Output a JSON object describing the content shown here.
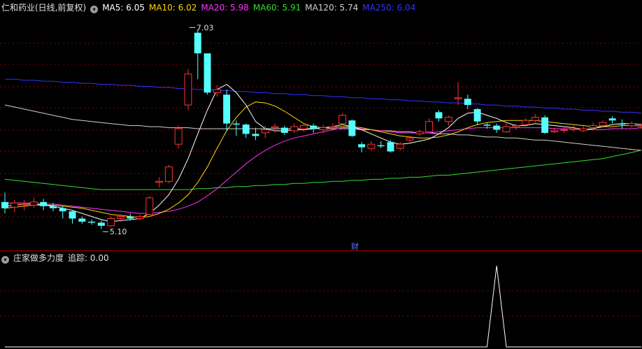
{
  "main_legend": {
    "title": "仁和药业(日线,前复权)",
    "items": [
      {
        "label": "MA5: 6.05",
        "color": "#ffffff"
      },
      {
        "label": "MA10: 6.02",
        "color": "#ffd700"
      },
      {
        "label": "MA20: 5.98",
        "color": "#ff33ff"
      },
      {
        "label": "MA60: 5.91",
        "color": "#33dd33"
      },
      {
        "label": "MA120: 5.74",
        "color": "#d0d0d0"
      },
      {
        "label": "MA250: 6.04",
        "color": "#3333ff"
      }
    ]
  },
  "indicator_legend": {
    "name": "庄家做多力度",
    "value_label": "追踪: 0.00"
  },
  "marker_label": "财",
  "chart_data": [
    {
      "type": "candlestick",
      "price_range": [
        5.0,
        7.1
      ],
      "max_annotation": {
        "label": "7.03",
        "value": 7.03,
        "index": 19
      },
      "min_annotation": {
        "label": "5.10",
        "value": 5.1,
        "index": 10
      },
      "colors": {
        "up": "#ff3232",
        "down": "#54ffff",
        "ma5": "#ffffff",
        "ma10": "#ffd700",
        "ma20": "#ff33ff",
        "ma60": "#33dd33",
        "ma120": "#d0d0d0",
        "ma250": "#3333ff"
      },
      "candles": [
        [
          5.36,
          5.3,
          5.45,
          5.25
        ],
        [
          5.31,
          5.35,
          5.38,
          5.26
        ],
        [
          5.34,
          5.34,
          5.38,
          5.28
        ],
        [
          5.33,
          5.36,
          5.4,
          5.3
        ],
        [
          5.36,
          5.32,
          5.39,
          5.28
        ],
        [
          5.32,
          5.3,
          5.35,
          5.27
        ],
        [
          5.3,
          5.27,
          5.32,
          5.2
        ],
        [
          5.27,
          5.2,
          5.28,
          5.15
        ],
        [
          5.2,
          5.17,
          5.22,
          5.15
        ],
        [
          5.17,
          5.16,
          5.19,
          5.14
        ],
        [
          5.16,
          5.13,
          5.18,
          5.1
        ],
        [
          5.13,
          5.2,
          5.22,
          5.12
        ],
        [
          5.2,
          5.22,
          5.24,
          5.17
        ],
        [
          5.22,
          5.2,
          5.25,
          5.18
        ],
        [
          5.2,
          5.22,
          5.24,
          5.18
        ],
        [
          5.24,
          5.4,
          5.42,
          5.23
        ],
        [
          5.55,
          5.56,
          5.6,
          5.5
        ],
        [
          5.56,
          5.7,
          5.72,
          5.54
        ],
        [
          5.92,
          6.07,
          6.1,
          5.88
        ],
        [
          6.3,
          6.6,
          6.65,
          6.25
        ],
        [
          7.0,
          6.8,
          7.03,
          6.55
        ],
        [
          6.8,
          6.42,
          6.78,
          6.4
        ],
        [
          6.42,
          6.45,
          6.49,
          6.38
        ],
        [
          6.4,
          6.12,
          6.45,
          6.05
        ],
        [
          6.12,
          6.11,
          6.15,
          6.0
        ],
        [
          6.11,
          6.02,
          6.12,
          5.98
        ],
        [
          6.02,
          6.0,
          6.08,
          5.96
        ],
        [
          6.03,
          6.06,
          6.1,
          5.98
        ],
        [
          6.08,
          6.09,
          6.12,
          6.03
        ],
        [
          6.08,
          6.03,
          6.1,
          6.01
        ],
        [
          6.05,
          6.09,
          6.12,
          6.03
        ],
        [
          6.07,
          6.1,
          6.12,
          6.04
        ],
        [
          6.1,
          6.07,
          6.12,
          6.03
        ],
        [
          6.06,
          6.08,
          6.11,
          6.03
        ],
        [
          6.08,
          6.09,
          6.12,
          6.05
        ],
        [
          6.12,
          6.2,
          6.22,
          6.11
        ],
        [
          6.15,
          6.0,
          6.16,
          5.99
        ],
        [
          5.92,
          5.89,
          5.94,
          5.84
        ],
        [
          5.88,
          5.92,
          5.95,
          5.86
        ],
        [
          5.91,
          5.9,
          5.95,
          5.88
        ],
        [
          5.94,
          5.85,
          5.96,
          5.84
        ],
        [
          5.88,
          5.92,
          5.94,
          5.86
        ],
        [
          5.96,
          5.98,
          6.0,
          5.94
        ],
        [
          6.02,
          6.04,
          6.06,
          6.0
        ],
        [
          6.04,
          6.14,
          6.17,
          6.03
        ],
        [
          6.23,
          6.17,
          6.25,
          6.14
        ],
        [
          6.14,
          6.18,
          6.2,
          6.1
        ],
        [
          6.36,
          6.37,
          6.52,
          6.3
        ],
        [
          6.36,
          6.3,
          6.4,
          6.26
        ],
        [
          6.26,
          6.14,
          6.27,
          6.11
        ],
        [
          6.11,
          6.1,
          6.13,
          6.07
        ],
        [
          6.1,
          6.06,
          6.12,
          6.03
        ],
        [
          6.04,
          6.09,
          6.12,
          6.03
        ],
        [
          6.09,
          6.1,
          6.12,
          6.06
        ],
        [
          6.11,
          6.15,
          6.17,
          6.09
        ],
        [
          6.15,
          6.18,
          6.21,
          6.13
        ],
        [
          6.18,
          6.03,
          6.2,
          6.02
        ],
        [
          6.04,
          6.05,
          6.08,
          6.03
        ],
        [
          6.06,
          6.06,
          6.09,
          6.03
        ],
        [
          6.06,
          6.07,
          6.1,
          6.04
        ],
        [
          6.05,
          6.07,
          6.11,
          6.04
        ],
        [
          6.08,
          6.1,
          6.13,
          6.06
        ],
        [
          6.1,
          6.13,
          6.15,
          6.09
        ],
        [
          6.17,
          6.15,
          6.19,
          6.12
        ],
        [
          6.12,
          6.11,
          6.16,
          6.07
        ],
        [
          6.1,
          6.12,
          6.14,
          6.08
        ],
        [
          6.09,
          6.1,
          6.12,
          6.07
        ]
      ],
      "ma5": [
        5.32,
        5.33,
        5.34,
        5.34,
        5.33,
        5.32,
        5.3,
        5.28,
        5.25,
        5.22,
        5.19,
        5.17,
        5.18,
        5.19,
        5.2,
        5.25,
        5.33,
        5.43,
        5.58,
        5.78,
        6.02,
        6.25,
        6.45,
        6.5,
        6.42,
        6.3,
        6.14,
        6.07,
        6.05,
        6.05,
        6.06,
        6.06,
        6.07,
        6.08,
        6.09,
        6.11,
        6.09,
        6.06,
        6.02,
        5.98,
        5.94,
        5.92,
        5.93,
        5.95,
        5.97,
        6.02,
        6.08,
        6.17,
        6.22,
        6.23,
        6.2,
        6.17,
        6.13,
        6.1,
        6.1,
        6.12,
        6.11,
        6.1,
        6.09,
        6.08,
        6.06,
        6.07,
        6.09,
        6.11,
        6.12,
        6.12,
        6.11
      ],
      "ma10": [
        5.3,
        5.31,
        5.32,
        5.33,
        5.33,
        5.33,
        5.32,
        5.31,
        5.3,
        5.28,
        5.26,
        5.24,
        5.23,
        5.22,
        5.21,
        5.22,
        5.25,
        5.29,
        5.35,
        5.43,
        5.55,
        5.7,
        5.88,
        6.05,
        6.18,
        6.28,
        6.33,
        6.32,
        6.29,
        6.24,
        6.18,
        6.12,
        6.09,
        6.08,
        6.08,
        6.09,
        6.09,
        6.08,
        6.06,
        6.04,
        6.02,
        6.0,
        5.99,
        5.98,
        5.98,
        5.99,
        6.01,
        6.04,
        6.08,
        6.11,
        6.13,
        6.14,
        6.15,
        6.15,
        6.15,
        6.15,
        6.14,
        6.13,
        6.12,
        6.11,
        6.1,
        6.09,
        6.09,
        6.09,
        6.1,
        6.1,
        6.1
      ],
      "ma20": [
        5.35,
        5.35,
        5.35,
        5.35,
        5.34,
        5.34,
        5.33,
        5.32,
        5.31,
        5.3,
        5.29,
        5.28,
        5.27,
        5.26,
        5.25,
        5.25,
        5.26,
        5.27,
        5.29,
        5.32,
        5.36,
        5.42,
        5.49,
        5.57,
        5.65,
        5.73,
        5.8,
        5.86,
        5.91,
        5.95,
        5.98,
        6.0,
        6.02,
        6.04,
        6.06,
        6.08,
        6.08,
        6.07,
        6.06,
        6.05,
        6.04,
        6.03,
        6.03,
        6.03,
        6.03,
        6.04,
        6.05,
        6.06,
        6.07,
        6.08,
        6.08,
        6.08,
        6.08,
        6.08,
        6.08,
        6.08,
        6.08,
        6.07,
        6.07,
        6.07,
        6.06,
        6.06,
        6.06,
        6.07,
        6.07,
        6.07,
        6.08
      ],
      "ma60": [
        5.58,
        5.57,
        5.56,
        5.55,
        5.54,
        5.53,
        5.52,
        5.51,
        5.5,
        5.49,
        5.48,
        5.48,
        5.48,
        5.48,
        5.48,
        5.48,
        5.48,
        5.48,
        5.48,
        5.48,
        5.49,
        5.49,
        5.5,
        5.5,
        5.51,
        5.51,
        5.52,
        5.52,
        5.53,
        5.53,
        5.54,
        5.54,
        5.55,
        5.55,
        5.56,
        5.56,
        5.57,
        5.57,
        5.58,
        5.58,
        5.59,
        5.59,
        5.6,
        5.6,
        5.61,
        5.62,
        5.62,
        5.63,
        5.64,
        5.65,
        5.66,
        5.67,
        5.68,
        5.69,
        5.7,
        5.71,
        5.72,
        5.73,
        5.74,
        5.75,
        5.76,
        5.77,
        5.78,
        5.8,
        5.82,
        5.84,
        5.86
      ],
      "ma120": [
        6.3,
        6.28,
        6.26,
        6.24,
        6.22,
        6.2,
        6.18,
        6.16,
        6.15,
        6.14,
        6.13,
        6.12,
        6.11,
        6.1,
        6.1,
        6.09,
        6.09,
        6.08,
        6.08,
        6.08,
        6.07,
        6.07,
        6.07,
        6.07,
        6.07,
        6.07,
        6.07,
        6.07,
        6.07,
        6.07,
        6.07,
        6.07,
        6.07,
        6.07,
        6.07,
        6.07,
        6.07,
        6.06,
        6.06,
        6.05,
        6.05,
        6.04,
        6.04,
        6.03,
        6.03,
        6.02,
        6.02,
        6.01,
        6.01,
        6.0,
        5.99,
        5.99,
        5.98,
        5.98,
        5.97,
        5.96,
        5.96,
        5.95,
        5.94,
        5.93,
        5.92,
        5.91,
        5.9,
        5.89,
        5.88,
        5.87,
        5.86
      ],
      "ma250": [
        6.55,
        6.55,
        6.54,
        6.54,
        6.53,
        6.53,
        6.52,
        6.52,
        6.51,
        6.51,
        6.5,
        6.5,
        6.49,
        6.49,
        6.48,
        6.48,
        6.47,
        6.47,
        6.46,
        6.46,
        6.45,
        6.45,
        6.44,
        6.44,
        6.43,
        6.43,
        6.42,
        6.42,
        6.41,
        6.41,
        6.4,
        6.4,
        6.39,
        6.39,
        6.38,
        6.38,
        6.37,
        6.37,
        6.36,
        6.36,
        6.35,
        6.35,
        6.34,
        6.34,
        6.33,
        6.33,
        6.32,
        6.32,
        6.31,
        6.31,
        6.3,
        6.3,
        6.29,
        6.29,
        6.28,
        6.28,
        6.27,
        6.27,
        6.26,
        6.26,
        6.25,
        6.25,
        6.24,
        6.24,
        6.23,
        6.23,
        6.22
      ]
    },
    {
      "type": "line",
      "name": "庄家做多力度",
      "value_range": [
        0,
        1
      ],
      "values": [
        0,
        0,
        0,
        0,
        0,
        0,
        0,
        0,
        0,
        0,
        0,
        0,
        0,
        0,
        0,
        0,
        0,
        0,
        0,
        0,
        0,
        0,
        0,
        0,
        0,
        0,
        0,
        0,
        0,
        0,
        0,
        0,
        0,
        0,
        0,
        0,
        0,
        0,
        0,
        0,
        0,
        0,
        0,
        0,
        0,
        0,
        0,
        0,
        0,
        0,
        0,
        1,
        0,
        0,
        0,
        0,
        0,
        0,
        0,
        0,
        0,
        0,
        0,
        0,
        0,
        0,
        0
      ]
    }
  ]
}
